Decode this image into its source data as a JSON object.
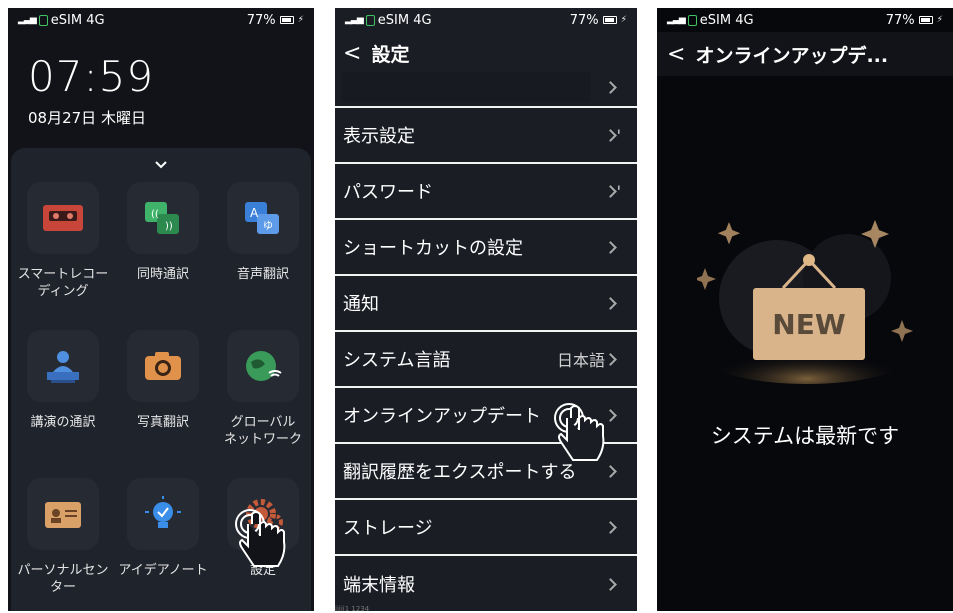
{
  "status": {
    "carrier": "eSIM 4G",
    "battery": "77%"
  },
  "phone1": {
    "time": "07:59",
    "date": "08月27日 木曜日",
    "apps": [
      {
        "label": "スマートレコー\nディング",
        "icon": "recorder-icon"
      },
      {
        "label": "同時通訳",
        "icon": "simultaneous-interpretation-icon"
      },
      {
        "label": "音声翻訳",
        "icon": "voice-translation-icon"
      },
      {
        "label": "講演の通訳",
        "icon": "lecture-interpretation-icon"
      },
      {
        "label": "写真翻訳",
        "icon": "camera-icon"
      },
      {
        "label": "グローバル\nネットワーク",
        "icon": "globe-wifi-icon"
      },
      {
        "label": "パーソナルセン\nター",
        "icon": "id-card-icon"
      },
      {
        "label": "アイデアノート",
        "icon": "lightbulb-icon"
      },
      {
        "label": "設定",
        "icon": "gear-icon"
      }
    ]
  },
  "phone2": {
    "title": "設定",
    "rows": [
      {
        "label": "",
        "value": ""
      },
      {
        "label": "表示設定",
        "value": "'"
      },
      {
        "label": "パスワード",
        "value": "'"
      },
      {
        "label": "ショートカットの設定",
        "value": ""
      },
      {
        "label": "通知",
        "value": ""
      },
      {
        "label": "システム言語",
        "value": "日本語"
      },
      {
        "label": "オンラインアップデート",
        "value": ""
      },
      {
        "label": "翻訳履歴をエクスポートする",
        "value": ""
      },
      {
        "label": "ストレージ",
        "value": ""
      },
      {
        "label": "端末情報",
        "value": ""
      }
    ],
    "footer_small": "iiiii1 1234"
  },
  "phone3": {
    "title": "オンラインアップデ...",
    "sign_text": "NEW",
    "message": "システムは最新です"
  },
  "colors": {
    "accent_orange": "#e07a3a",
    "sign_bg": "#d9b48a",
    "sign_text": "#5a4a3a"
  }
}
